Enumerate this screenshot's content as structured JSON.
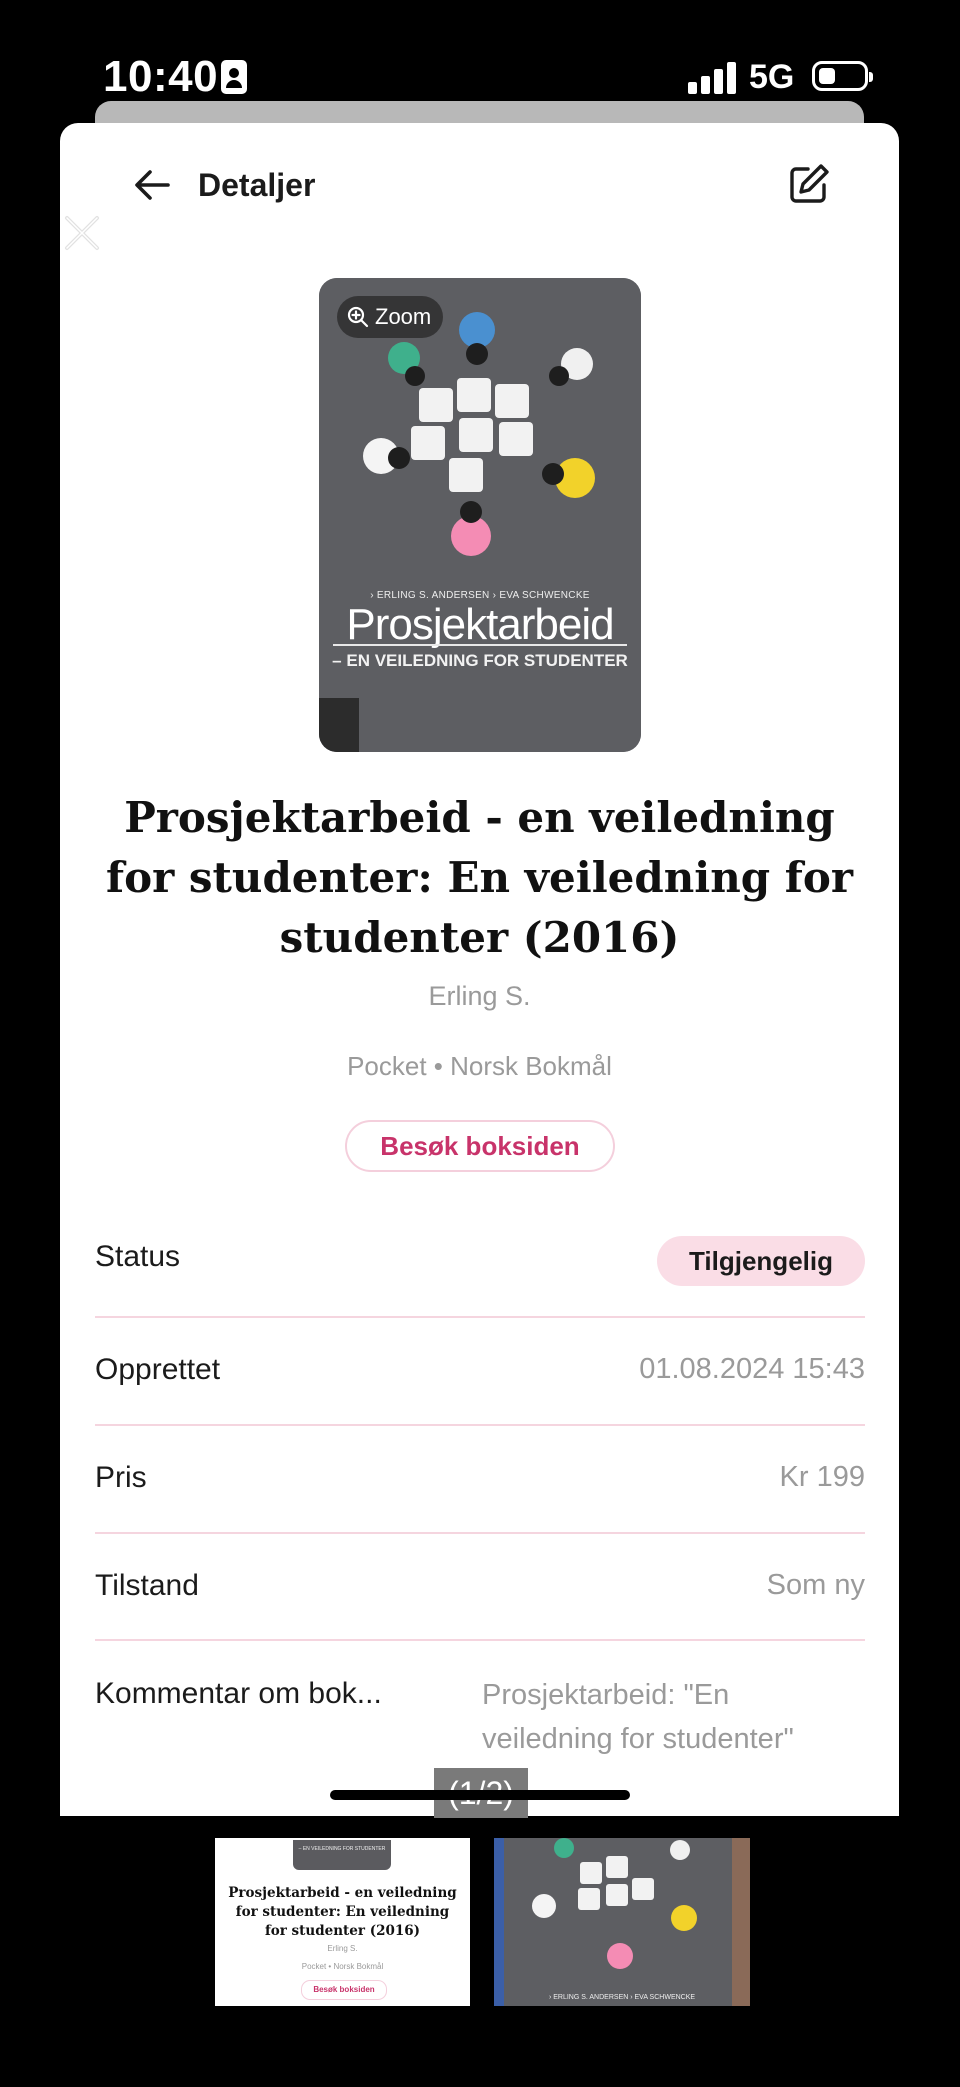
{
  "status_bar": {
    "time": "10:40",
    "network": "5G"
  },
  "header": {
    "title": "Detaljer"
  },
  "cover": {
    "zoom_label": "Zoom",
    "authors": "› ERLING S. ANDERSEN  › EVA SCHWENCKE",
    "title": "Prosjektarbeid",
    "subtitle": "– EN VEILEDNING FOR STUDENTER"
  },
  "book": {
    "title": "Prosjektarbeid - en veiledning for studenter: En veiledning for studenter (2016)",
    "author": "Erling S.",
    "format_language": "Pocket • Norsk Bokmål",
    "visit_button": "Besøk boksiden"
  },
  "details": {
    "status_label": "Status",
    "status_value": "Tilgjengelig",
    "created_label": "Opprettet",
    "created_value": "01.08.2024 15:43",
    "price_label": "Pris",
    "price_value": "Kr 199",
    "condition_label": "Tilstand",
    "condition_value": "Som ny",
    "comment_label": "Kommentar om bok...",
    "comment_value": "Prosjektarbeid: \"En veiledning for studenter\""
  },
  "pager": "(1/2)",
  "thumbnails": {
    "thumb1_cover_text": "– EN VEILEDNING FOR STUDENTER",
    "thumb1_title": "Prosjektarbeid - en veiledning for studenter: En veiledning for studenter (2016)",
    "thumb1_author": "Erling S.",
    "thumb1_meta": "Pocket • Norsk Bokmål",
    "thumb1_button": "Besøk boksiden",
    "thumb2_authors": "› ERLING S. ANDERSEN  › EVA SCHWENCKE"
  },
  "colors": {
    "accent": "#c8336a",
    "pill_bg": "#fadde6",
    "divider": "#f5d5df"
  }
}
